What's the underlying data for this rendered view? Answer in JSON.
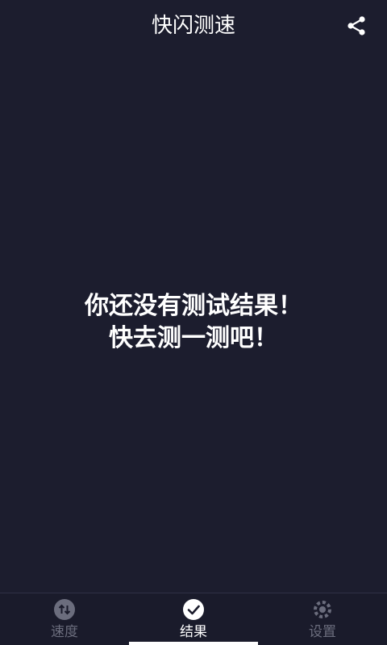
{
  "header": {
    "title": "快闪测速",
    "share_icon": "share-icon"
  },
  "main": {
    "empty_line1": "你还没有测试结果！",
    "empty_line2": "快去测一测吧！"
  },
  "nav": {
    "active_index": 1,
    "items": [
      {
        "label": "速度",
        "icon": "transfer-arrows-icon"
      },
      {
        "label": "结果",
        "icon": "check-circle-icon"
      },
      {
        "label": "设置",
        "icon": "settings-icon"
      }
    ]
  },
  "colors": {
    "background": "#1c1d2e",
    "text": "#ffffff",
    "inactive": "#6b6d7d"
  }
}
